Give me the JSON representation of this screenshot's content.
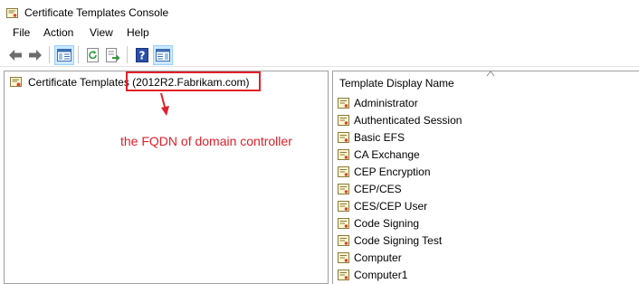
{
  "window": {
    "title": "Certificate Templates Console"
  },
  "menu": [
    "File",
    "Action",
    "View",
    "Help"
  ],
  "toolbar": {
    "buttons": [
      "back-icon",
      "forward-icon",
      "show-hide-console-tree-icon",
      "refresh-icon",
      "export-list-icon",
      "help-icon",
      "show-hide-action-pane-icon"
    ]
  },
  "tree": {
    "root_label": "Certificate Templates (2012R2.Fabrikam.com)"
  },
  "annotation": {
    "text": "the FQDN of domain controller",
    "color": "#e0202a"
  },
  "list": {
    "column_header": "Template Display Name",
    "items": [
      "Administrator",
      "Authenticated Session",
      "Basic EFS",
      "CA Exchange",
      "CEP Encryption",
      "CEP/CES",
      "CES/CEP User",
      "Code Signing",
      "Code Signing Test",
      "Computer",
      "Computer1"
    ]
  }
}
